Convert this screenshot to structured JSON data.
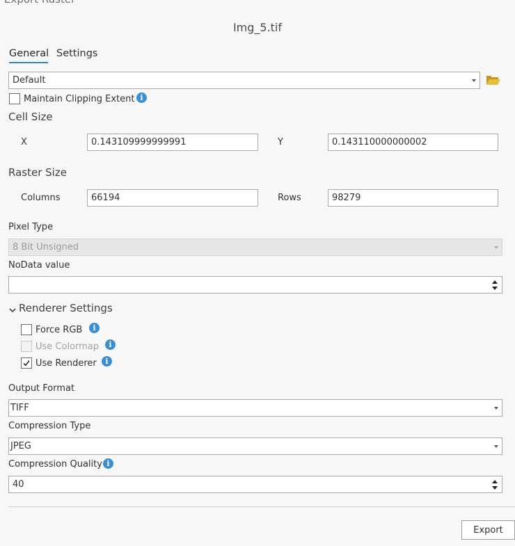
{
  "pane": {
    "title": "Export Raster",
    "file_name": "Img_5.tif"
  },
  "tabs": [
    {
      "label": "General"
    },
    {
      "label": "Settings"
    }
  ],
  "output_coordinate_system": {
    "value": "Default"
  },
  "maintain_clipping_extent": {
    "label": "Maintain Clipping Extent",
    "checked": false
  },
  "cell_size": {
    "heading": "Cell Size",
    "x_label": "X",
    "x_value": "0.143109999999991",
    "y_label": "Y",
    "y_value": "0.143110000000002"
  },
  "raster_size": {
    "heading": "Raster Size",
    "columns_label": "Columns",
    "columns_value": "66194",
    "rows_label": "Rows",
    "rows_value": "98279"
  },
  "pixel_type": {
    "label": "Pixel Type",
    "value": "8 Bit Unsigned"
  },
  "nodata": {
    "label": "NoData value",
    "value": ""
  },
  "renderer_settings": {
    "heading": "Renderer Settings",
    "force_rgb": {
      "label": "Force RGB",
      "checked": false
    },
    "use_colormap": {
      "label": "Use Colormap",
      "checked": false
    },
    "use_renderer": {
      "label": "Use Renderer",
      "checked": true
    }
  },
  "output_format": {
    "label": "Output Format",
    "value": "TIFF"
  },
  "compression_type": {
    "label": "Compression Type",
    "value": "JPEG"
  },
  "compression_quality": {
    "label": "Compression Quality",
    "value": "40"
  },
  "export_button": {
    "label": "Export"
  },
  "colors": {
    "accent": "#2f7fc1",
    "info": "#3b8fd0",
    "folder": "#e2b23a"
  }
}
